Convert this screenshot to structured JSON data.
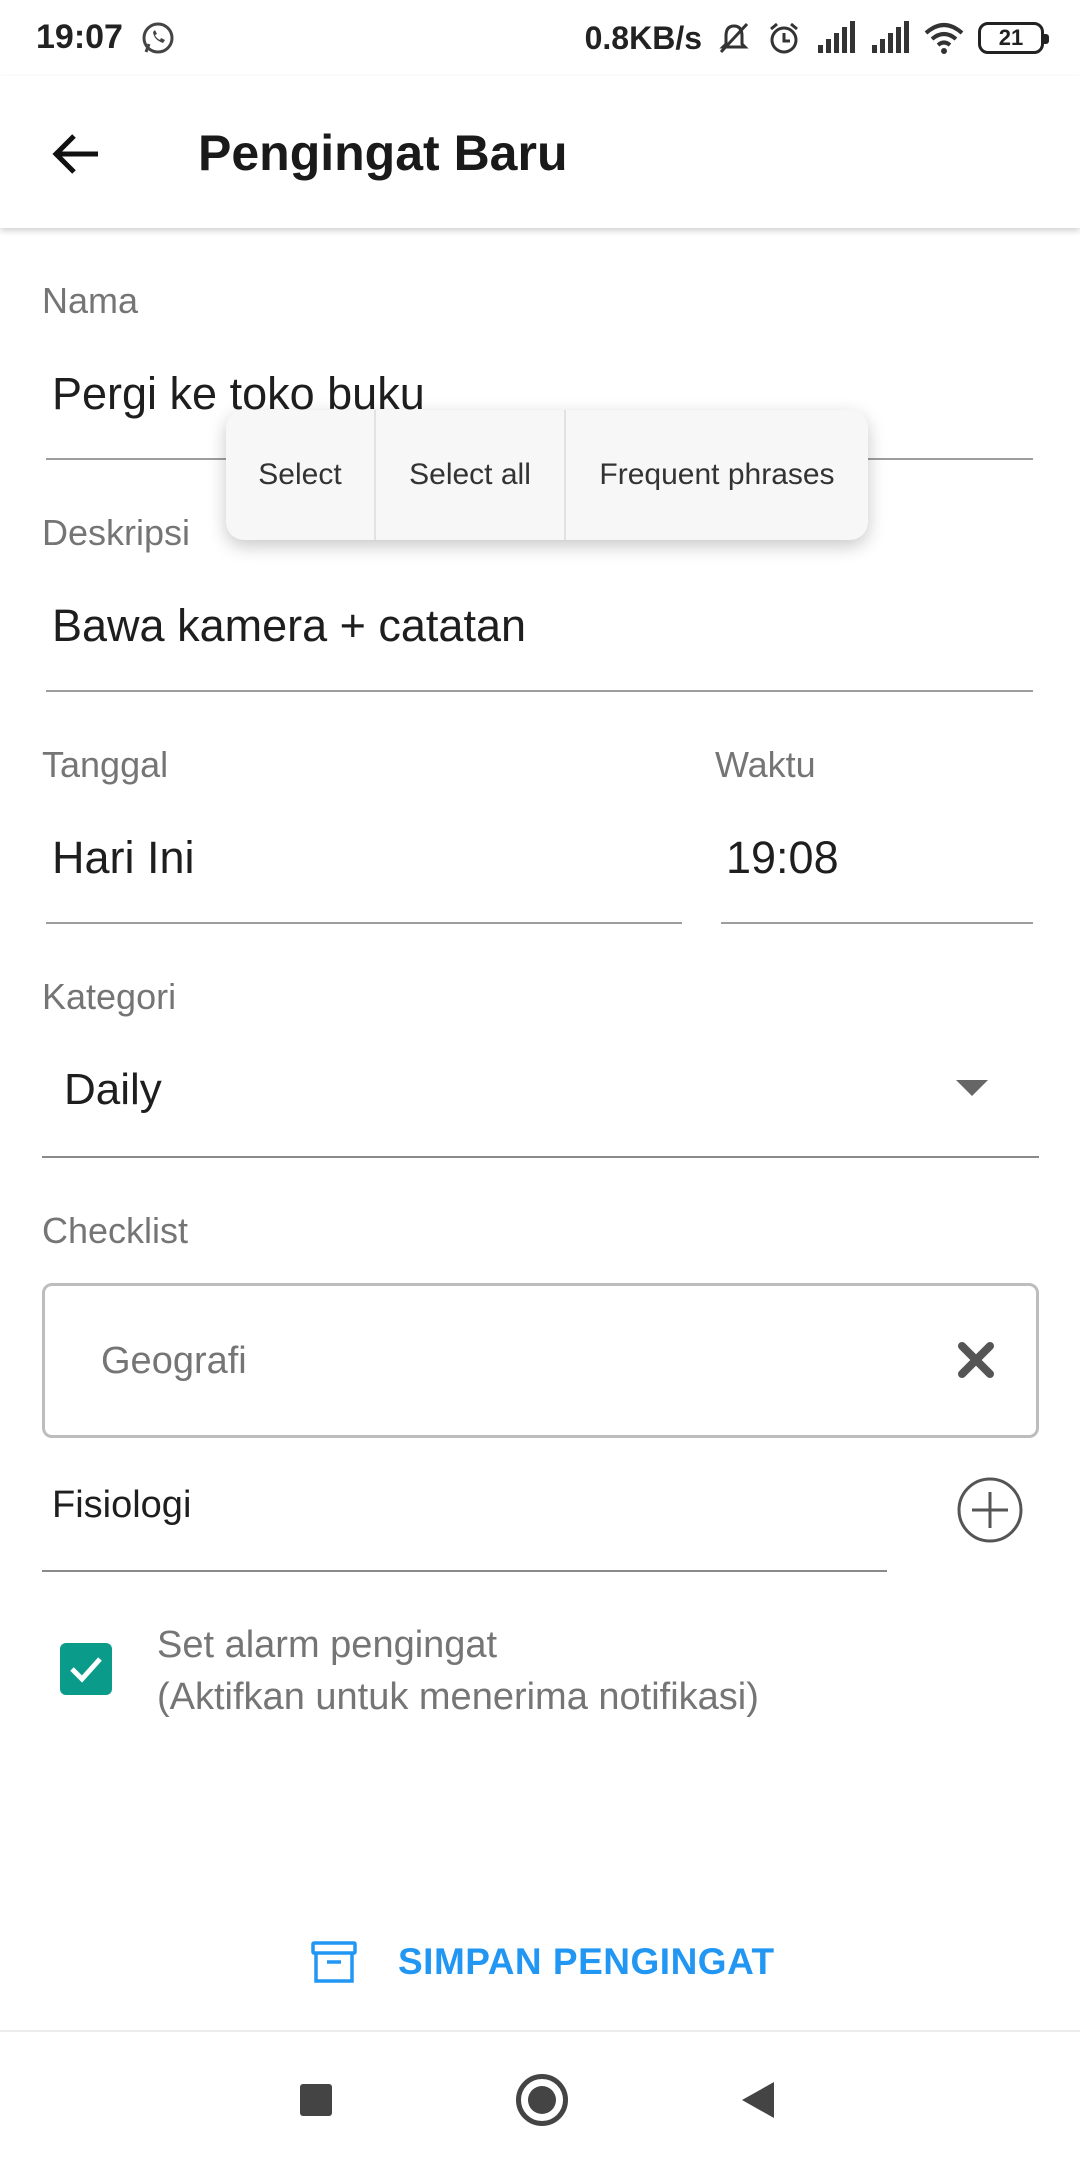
{
  "status_bar": {
    "time": "19:07",
    "network_speed": "0.8KB/s",
    "battery": "21",
    "icons": [
      "whatsapp-icon",
      "mute-icon",
      "alarm-icon",
      "signal-icon",
      "signal-icon",
      "wifi-icon",
      "battery-icon"
    ]
  },
  "app_bar": {
    "title": "Pengingat Baru",
    "back_icon": "arrow-back-icon"
  },
  "form": {
    "name": {
      "label": "Nama",
      "value": "Pergi ke toko buku"
    },
    "description": {
      "label": "Deskripsi",
      "value": "Bawa kamera + catatan"
    },
    "date": {
      "label": "Tanggal",
      "value": "Hari Ini"
    },
    "time": {
      "label": "Waktu",
      "value": "19:08"
    },
    "category": {
      "label": "Kategori",
      "value": "Daily"
    },
    "checklist": {
      "label": "Checklist",
      "items": [
        "Geografi"
      ],
      "new_item_value": "Fisiologi"
    },
    "alarm": {
      "checked": true,
      "line1": "Set alarm pengingat",
      "line2": "(Aktifkan untuk menerima notifikasi)"
    }
  },
  "context_menu": {
    "items": [
      "Select",
      "Select all",
      "Frequent phrases"
    ]
  },
  "save_button": {
    "label": "SIMPAN PENGINGAT",
    "icon": "archive-icon"
  },
  "colors": {
    "accent": "#2196f3",
    "checkbox": "#0b9b8a",
    "label": "#757575"
  }
}
